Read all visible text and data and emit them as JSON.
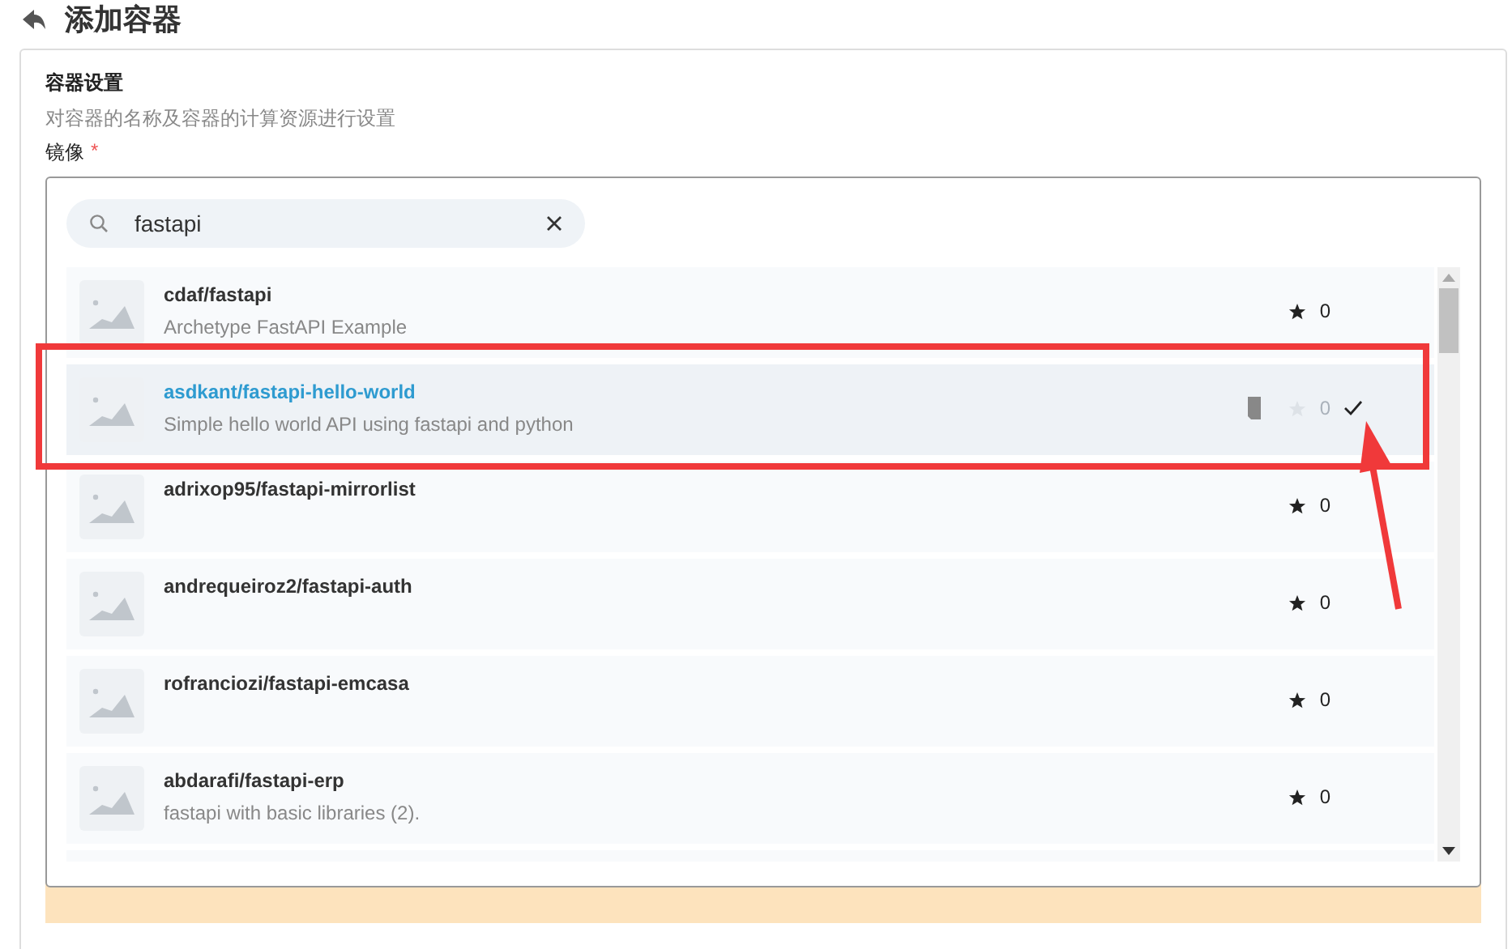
{
  "page_title": "添加容器",
  "section": {
    "title": "容器设置",
    "description": "对容器的名称及容器的计算资源进行设置"
  },
  "image_field": {
    "label": "镜像",
    "required_mark": "*"
  },
  "search": {
    "value": "fastapi"
  },
  "results": [
    {
      "name": "cdaf/fastapi",
      "description": "Archetype FastAPI Example",
      "stars": "0",
      "selected": false
    },
    {
      "name": "asdkant/fastapi-hello-world",
      "description": "Simple hello world API using fastapi and python",
      "stars": "0",
      "selected": true
    },
    {
      "name": "adrixop95/fastapi-mirrorlist",
      "stars": "0",
      "selected": false
    },
    {
      "name": "andrequeiroz2/fastapi-auth",
      "stars": "0",
      "selected": false
    },
    {
      "name": "rofranciozi/fastapi-emcasa",
      "stars": "0",
      "selected": false
    },
    {
      "name": "abdarafi/fastapi-erp",
      "description": "fastapi with basic libraries (2).",
      "stars": "0",
      "selected": false
    }
  ]
}
